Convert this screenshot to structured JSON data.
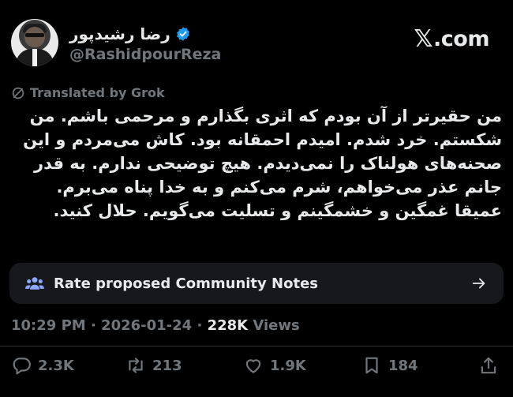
{
  "header": {
    "display_name": "رضا رشیدپور",
    "handle": "@RashidpourReza",
    "brand": ".com",
    "brand_mark": "𝕏"
  },
  "translation": {
    "label": "Translated by Grok"
  },
  "post": {
    "lines": [
      "من حقیرتر از آن بودم که اثری بگذارم و مرحمی باشم. من",
      "شکستم. خرد شدم. امیدم احمقانه بود. کاش می‌مردم و این",
      "صحنه‌های هولناک را نمی‌دیدم. هیچ توضیحی ندارم. به قدر",
      "جانم  عذر می‌خواهم، شرم می‌کنم و به خدا پناه می‌برم.",
      "عمیقا غمگین و خشمگینم و تسلیت می‌گویم. حلال کنید."
    ]
  },
  "community_notes": {
    "label": "Rate proposed Community Notes"
  },
  "meta": {
    "time": "10:29 PM",
    "sep1": " · ",
    "date": "2026-01-24",
    "sep2": " · ",
    "views_count": "228K",
    "views_label": " Views"
  },
  "actions": {
    "replies": "2.3K",
    "reposts": "213",
    "likes": "1.9K",
    "bookmarks": "184"
  },
  "colors": {
    "background": "#000000",
    "text": "#e7e9ea",
    "muted": "#71767b",
    "verified": "#1d9bf0",
    "card": "#16181c"
  }
}
